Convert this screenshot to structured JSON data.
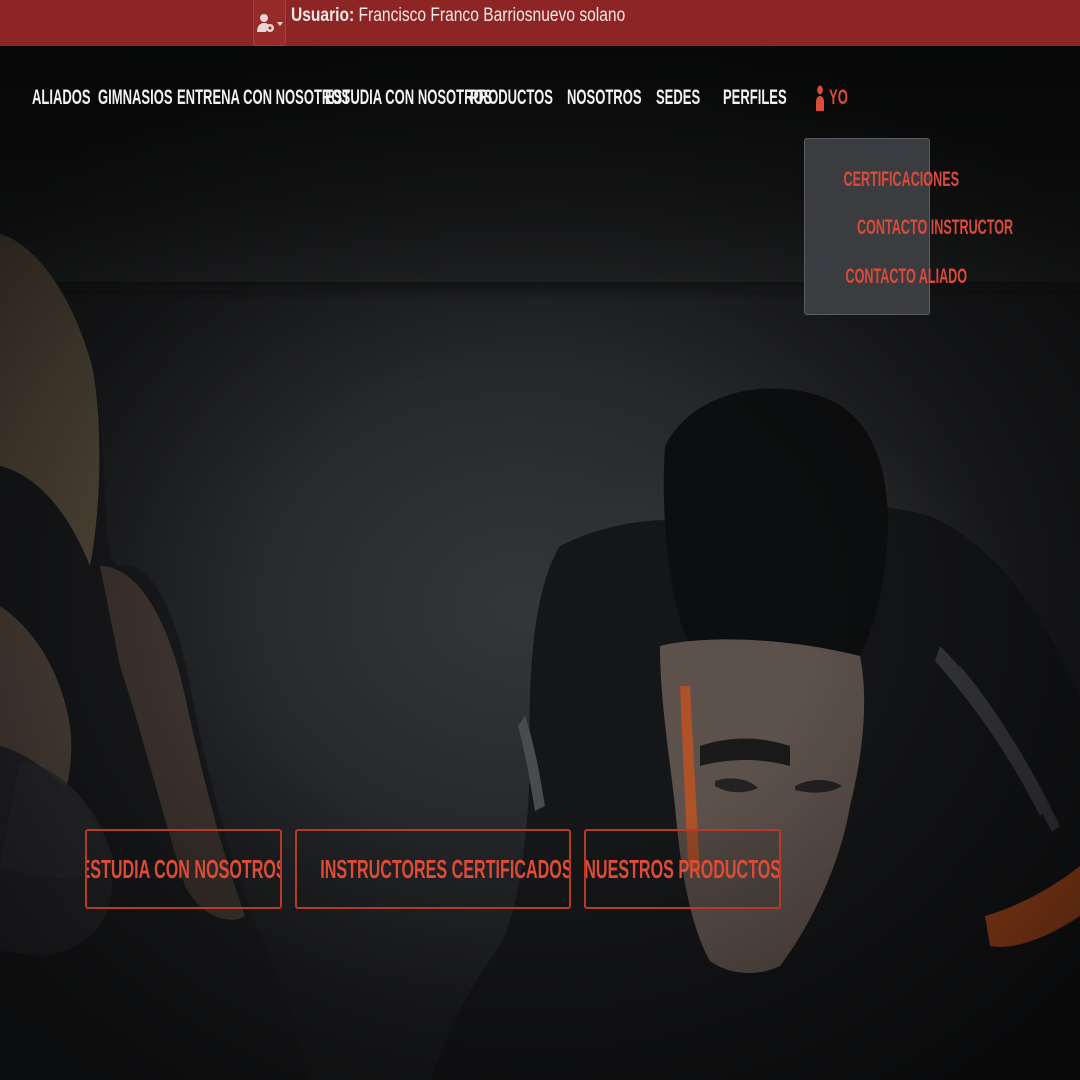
{
  "topbar": {
    "user_label": "Usuario:",
    "user_name": "Francisco Franco Barriosnuevo solano",
    "menu_icon": "user-gear-icon"
  },
  "nav": {
    "items": [
      {
        "label": "ALIADOS"
      },
      {
        "label": "GIMNASIOS"
      },
      {
        "label": "ENTRENA CON NOSOTROS"
      },
      {
        "label": "ESTUDIA CON NOSOTROS"
      },
      {
        "label": "PRODUCTOS"
      },
      {
        "label": "NOSOTROS"
      },
      {
        "label": "SEDES"
      },
      {
        "label": "PERFILES"
      }
    ],
    "user_item": {
      "label": "YO",
      "icon": "user-icon"
    }
  },
  "dropdown": {
    "items": [
      {
        "label": "CERTIFICACIONES"
      },
      {
        "label": "CONTACTO INSTRUCTOR"
      },
      {
        "label": "CONTACTO ALIADO"
      }
    ]
  },
  "cta": {
    "study": "ESTUDIA CON NOSOTROS",
    "instructors": "INSTRUCTORES CERTIFICADOS",
    "instructors_icon": "graduation-cap-icon",
    "products": "NUESTROS PRODUCTOS"
  },
  "colors": {
    "topbar": "#8c2523",
    "accent": "#dc4a3a",
    "cap_icon": "#e8a11c",
    "nav_text": "#f2f2f2"
  }
}
